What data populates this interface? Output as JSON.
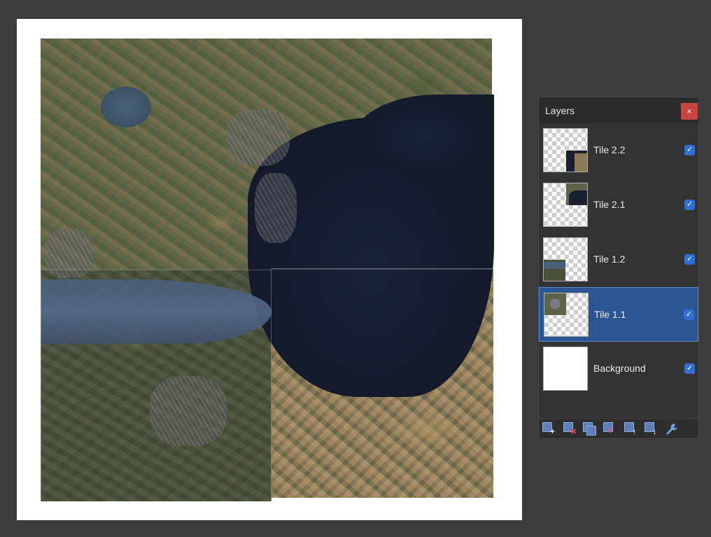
{
  "panel": {
    "title": "Layers",
    "close_glyph": "×"
  },
  "layers": [
    {
      "name": "Tile 2.2",
      "visible": true,
      "selected": false
    },
    {
      "name": "Tile 2.1",
      "visible": true,
      "selected": false
    },
    {
      "name": "Tile 1.2",
      "visible": true,
      "selected": false
    },
    {
      "name": "Tile 1.1",
      "visible": true,
      "selected": true
    },
    {
      "name": "Background",
      "visible": true,
      "selected": false
    }
  ],
  "checkbox_glyph": "✓",
  "toolbar": {
    "tools": [
      {
        "icon": "add-layer-icon",
        "glyph": "+",
        "color": "#ffffff"
      },
      {
        "icon": "delete-layer-icon",
        "glyph": "✖",
        "color": "#e04040"
      },
      {
        "icon": "duplicate-layer-icon",
        "glyph": "",
        "color": "#ffffff"
      },
      {
        "icon": "merge-layer-down-icon",
        "glyph": "⬇",
        "color": "#e05090"
      },
      {
        "icon": "move-layer-up-icon",
        "glyph": "↑",
        "color": "#ffffff"
      },
      {
        "icon": "move-layer-down-icon",
        "glyph": "↓",
        "color": "#ffffff"
      },
      {
        "icon": "layer-properties-icon",
        "glyph": "🔧",
        "color": "#6fa0e0"
      }
    ]
  },
  "colors": {
    "accent": "#2c5594",
    "close": "#c8453f",
    "checkbox": "#2f6fd0"
  }
}
